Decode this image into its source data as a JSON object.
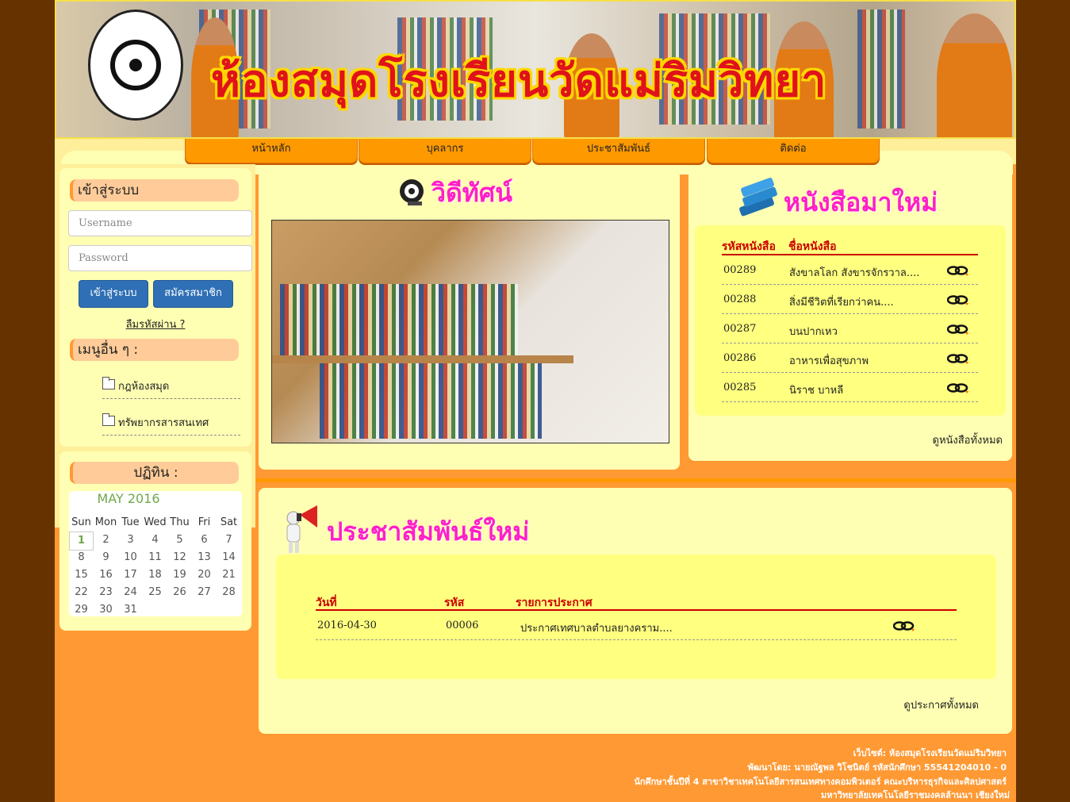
{
  "header": {
    "title": "ห้องสมุดโรงเรียนวัดแม่ริมวิทยา"
  },
  "nav": {
    "items": [
      "หน้าหลัก",
      "บุคลากร",
      "ประชาสัมพันธ์",
      "ติดต่อ"
    ]
  },
  "login": {
    "heading": "เข้าสู่ระบบ",
    "username_placeholder": "Username",
    "password_placeholder": "Password",
    "login_button": "เข้าสู่ระบบ",
    "register_button": "สมัครสมาชิก",
    "forgot_link": "ลืมรหัสผ่าน ?"
  },
  "other_menu": {
    "heading": "เมนูอื่น ๆ :",
    "items": [
      "กฎห้องสมุด",
      "ทรัพยากรสารสนเทศ"
    ]
  },
  "calendar": {
    "heading": "ปฏิทิน :",
    "month_title": "MAY 2016",
    "weekdays": [
      "Sun",
      "Mon",
      "Tue",
      "Wed",
      "Thu",
      "Fri",
      "Sat"
    ],
    "weeks": [
      [
        "1",
        "2",
        "3",
        "4",
        "5",
        "6",
        "7"
      ],
      [
        "8",
        "9",
        "10",
        "11",
        "12",
        "13",
        "14"
      ],
      [
        "15",
        "16",
        "17",
        "18",
        "19",
        "20",
        "21"
      ],
      [
        "22",
        "23",
        "24",
        "25",
        "26",
        "27",
        "28"
      ],
      [
        "29",
        "30",
        "31",
        "",
        "",
        "",
        ""
      ]
    ],
    "today": "1"
  },
  "video": {
    "title": "วิดีทัศน์"
  },
  "new_books": {
    "title": "หนังสือมาใหม่",
    "columns": [
      "รหัสหนังสือ",
      "ชื่อหนังสือ"
    ],
    "rows": [
      {
        "code": "00289",
        "name": "สังขาลโลก สังขารจักรวาล...."
      },
      {
        "code": "00288",
        "name": "สิ่งมีชีวิตที่เรียกว่าคน...."
      },
      {
        "code": "00287",
        "name": "บนปากเหว"
      },
      {
        "code": "00286",
        "name": "อาหารเพื่อสุขภาพ"
      },
      {
        "code": "00285",
        "name": "นิราช บาหลี"
      }
    ],
    "view_all": "ดูหนังสือทั้งหมด"
  },
  "news": {
    "title": "ประชาสัมพันธ์ใหม่",
    "columns": [
      "วันที่",
      "รหัส",
      "รายการประกาศ"
    ],
    "rows": [
      {
        "date": "2016-04-30",
        "code": "00006",
        "text": "ประกาศเทศบาลตำบลยางคราม...."
      }
    ],
    "view_all": "ดูประกาศทั้งหมด"
  },
  "footer": {
    "lines": [
      "เว็บไซต์: ห้องสมุดโรงเรียนวัดแม่ริมวิทยา",
      "พัฒนาโดย: นายณัฐพล วิโชนิตย์ รหัสนักศึกษา 55541204010 - 0",
      "นักศึกษาชั้นปีที่ 4 สาขาวิชาเทคโนโลยีสารสนเทศทางคอมพิวเตอร์ คณะบริหารธุรกิจและศิลปศาสตร์",
      "มหาวิทยาลัยเทคโนโลยีราชมงคลล้านนา เชียงใหม่"
    ]
  },
  "colors": {
    "background": "#663300",
    "accent": "#ff9933",
    "panel": "#ffffb3",
    "title_pink": "#ff1fc8",
    "header_red": "#cc0000"
  }
}
